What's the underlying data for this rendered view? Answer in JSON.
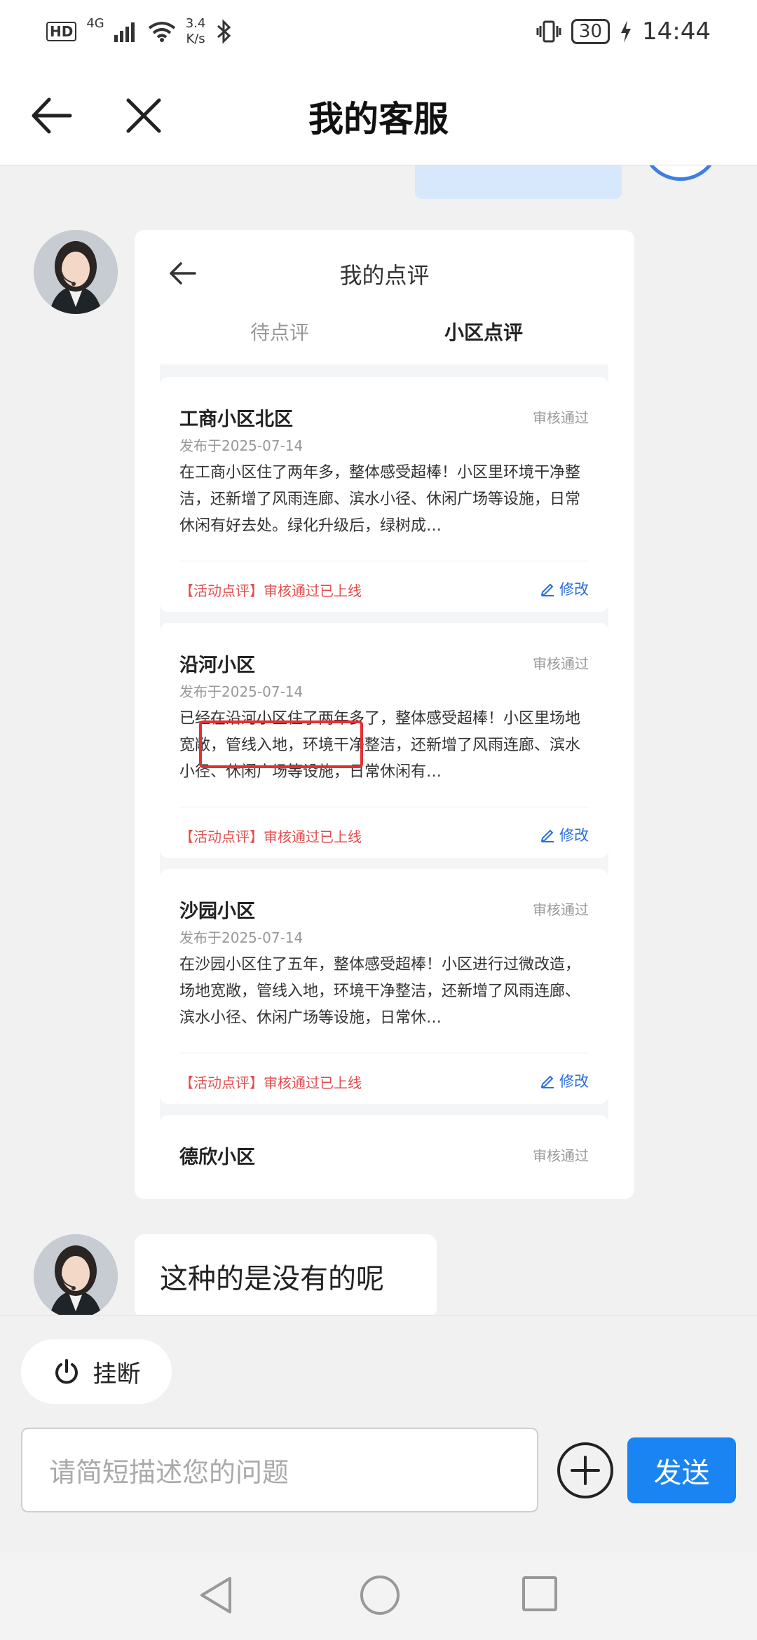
{
  "status_bar": {
    "hd": "HD",
    "network": "4G",
    "speed_value": "3.4",
    "speed_unit": "K/s",
    "battery": "30",
    "time": "14:44"
  },
  "header": {
    "title": "我的客服"
  },
  "screenshot": {
    "title": "我的点评",
    "tabs": [
      "待点评",
      "小区点评"
    ],
    "reviews": [
      {
        "name": "工商小区北区",
        "status": "审核通过",
        "date": "发布于2025-07-14",
        "text": "在工商小区住了两年多，整体感受超棒！小区里环境干净整洁，还新增了风雨连廊、滨水小径、休闲广场等设施，日常休闲有好去处。绿化升级后，绿树成…",
        "tag": "【活动点评】审核通过已上线",
        "edit": "修改"
      },
      {
        "name": "沿河小区",
        "status": "审核通过",
        "date": "发布于2025-07-14",
        "text": "已经在沿河小区住了两年多了，整体感受超棒！小区里场地宽敞，管线入地，环境干净整洁，还新增了风雨连廊、滨水小径、休闲广场等设施，日常休闲有…",
        "tag": "【活动点评】审核通过已上线",
        "edit": "修改"
      },
      {
        "name": "沙园小区",
        "status": "审核通过",
        "date": "发布于2025-07-14",
        "text": "在沙园小区住了五年，整体感受超棒！小区进行过微改造，场地宽敞，管线入地，环境干净整洁，还新增了风雨连廊、滨水小径、休闲广场等设施，日常休…",
        "tag": "【活动点评】审核通过已上线",
        "edit": "修改"
      },
      {
        "name": "德欣小区",
        "status": "审核通过",
        "date": "",
        "text": "",
        "tag": "",
        "edit": ""
      }
    ]
  },
  "messages": {
    "agent_reply": "这种的是没有的呢"
  },
  "actions": {
    "hangup_label": "挂断",
    "input_placeholder": "请简短描述您的问题",
    "send_label": "发送"
  },
  "colors": {
    "accent": "#1a84f2",
    "highlight": "#e53030",
    "tag_red": "#e24d4d",
    "link_blue": "#2a6fe0"
  }
}
